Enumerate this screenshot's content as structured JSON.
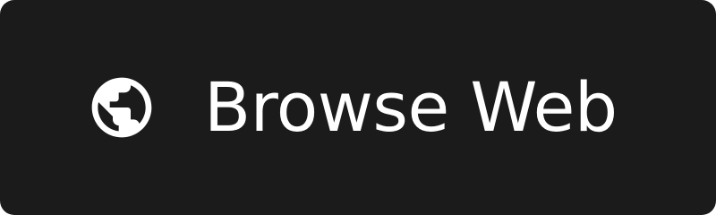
{
  "button": {
    "label": "Browse Web",
    "icon": "globe-icon",
    "background_color": "#1b1b1b",
    "text_color": "#ffffff"
  }
}
